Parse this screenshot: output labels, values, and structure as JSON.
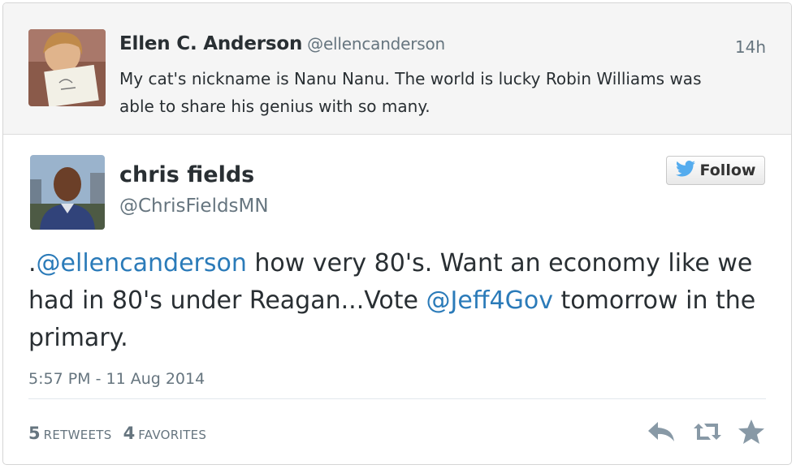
{
  "parent_tweet": {
    "name": "Ellen C. Anderson",
    "handle": "@ellencanderson",
    "time": "14h",
    "text": "My cat's nickname is Nanu Nanu. The world is lucky Robin Williams was able to share his genius with so many."
  },
  "tweet": {
    "name": "chris fields",
    "handle": "@ChrisFieldsMN",
    "follow_label": "Follow",
    "text_parts": {
      "p1": ".",
      "m1": "@ellencanderson",
      "p2": " how very 80's. Want an economy like we had in 80's under Reagan...Vote ",
      "m2": "@Jeff4Gov",
      "p3": " tomorrow in the primary."
    },
    "timestamp": "5:57 PM - 11 Aug 2014",
    "retweets_count": "5",
    "retweets_label": "RETWEETS",
    "favorites_count": "4",
    "favorites_label": "FAVORITES"
  },
  "icons": {
    "bird": "twitter-bird-icon",
    "reply": "reply-icon",
    "retweet": "retweet-icon",
    "favorite": "star-icon"
  },
  "colors": {
    "link": "#2b7bb9",
    "twitter_blue": "#55acee",
    "muted": "#66757f",
    "action_icon": "#8899a6"
  }
}
